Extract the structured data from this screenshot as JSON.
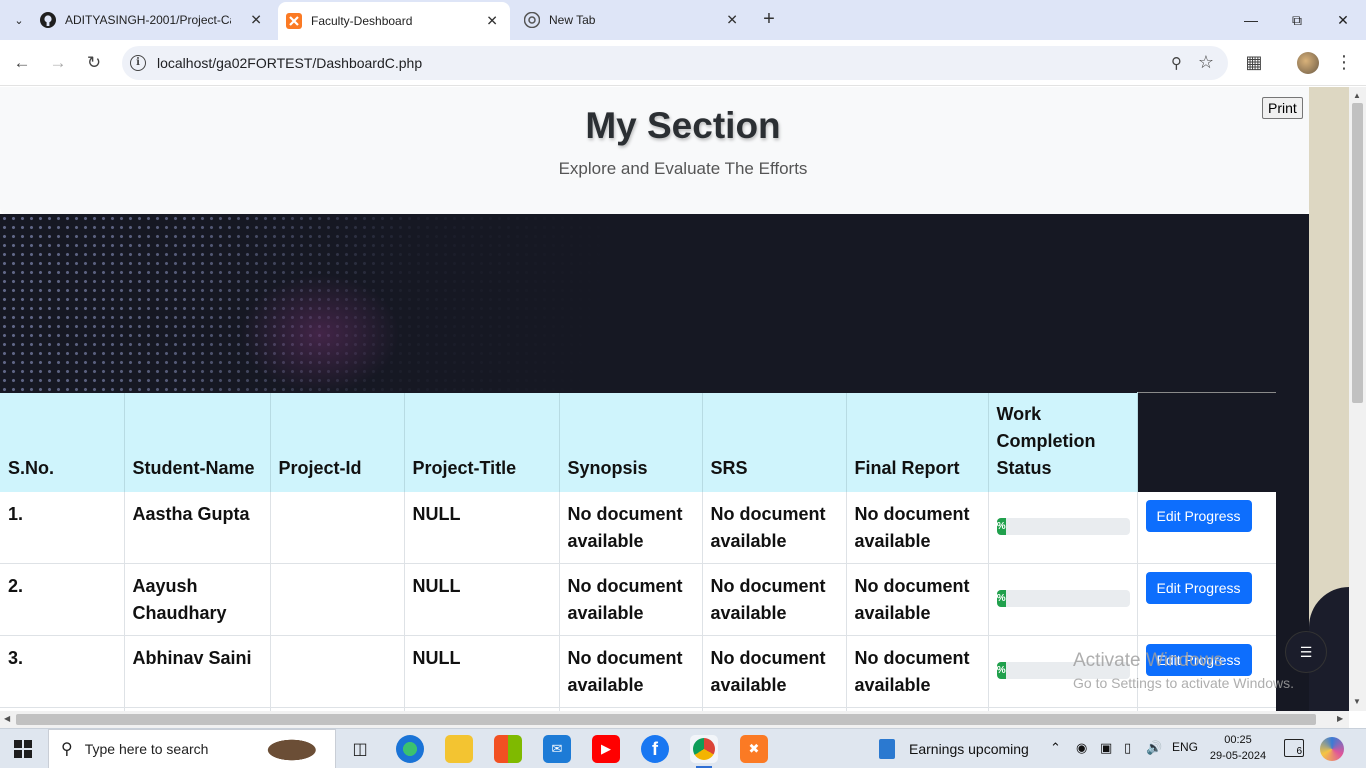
{
  "browser": {
    "tabs": [
      {
        "title": "ADITYASINGH-2001/Project-Ca",
        "icon": "github-icon",
        "active": false
      },
      {
        "title": "Faculty-Deshboard",
        "icon": "xampp-icon",
        "active": true
      },
      {
        "title": "New Tab",
        "icon": "chrome-icon",
        "active": false
      }
    ],
    "new_tab_label": "+",
    "url": "localhost/ga02FORTEST/DashboardC.php"
  },
  "page": {
    "title": "My Section",
    "subtitle": "Explore and Evaluate The Efforts",
    "print_label": "Print",
    "table": {
      "headers": [
        "S.No.",
        "Student-Name",
        "Project-Id",
        "Project-Title",
        "Synopsis",
        "SRS",
        "Final Report",
        "Work Completion Status",
        ""
      ],
      "rows": [
        {
          "sno": "1.",
          "name": "Aastha Gupta",
          "project_id": "",
          "project_title": "NULL",
          "synopsis": "No document available",
          "srs": "No document available",
          "final_report": "No document available",
          "progress_pct": 0,
          "progress_label": "%",
          "action": "Edit Progress"
        },
        {
          "sno": "2.",
          "name": "Aayush Chaudhary",
          "project_id": "",
          "project_title": "NULL",
          "synopsis": "No document available",
          "srs": "No document available",
          "final_report": "No document available",
          "progress_pct": 0,
          "progress_label": "%",
          "action": "Edit Progress"
        },
        {
          "sno": "3.",
          "name": "Abhinav Saini",
          "project_id": "",
          "project_title": "NULL",
          "synopsis": "No document available",
          "srs": "No document available",
          "final_report": "No document available",
          "progress_pct": 0,
          "progress_label": "%",
          "action": "Edit Progress"
        }
      ]
    }
  },
  "watermark": {
    "line1": "Activate Windows",
    "line2": "Go to Settings to activate Windows."
  },
  "taskbar": {
    "search_placeholder": "Type here to search",
    "news_text": "Earnings upcoming",
    "language": "ENG",
    "time": "00:25",
    "date": "29-05-2024",
    "notifications": "6"
  },
  "colors": {
    "header_bg": "#cff4fc",
    "edit_button": "#0d6efd",
    "progress_fill": "#20a04c",
    "hero_bg": "#f8f9fa"
  }
}
